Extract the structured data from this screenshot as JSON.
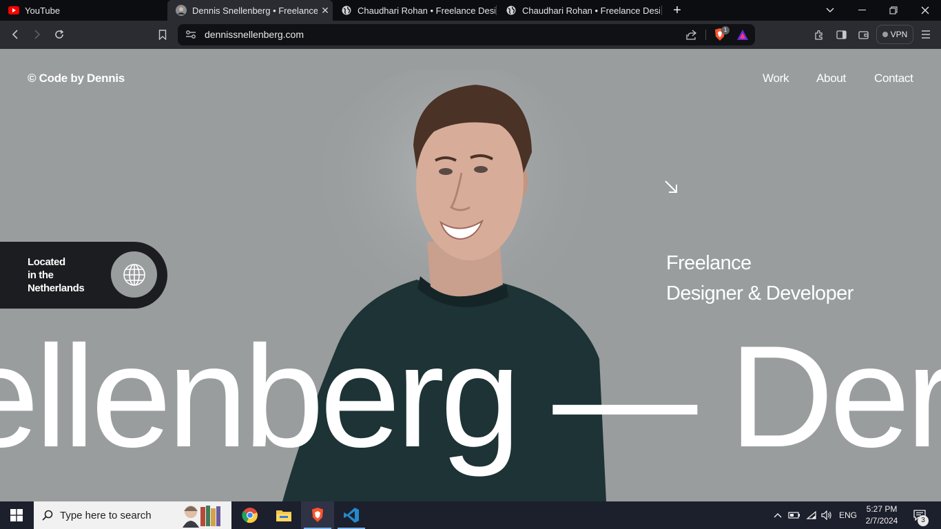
{
  "browser": {
    "tabs": [
      {
        "title": "YouTube",
        "icon": "youtube-icon",
        "active": false
      },
      {
        "title": "Dennis Snellenberg • Freelance Designer & Developer",
        "icon": "avatar-icon",
        "active": true
      },
      {
        "title": "Chaudhari Rohan • Freelance Designer & Developer",
        "icon": "globe-icon",
        "active": false
      },
      {
        "title": "Chaudhari Rohan • Freelance Designer & Developer",
        "icon": "globe-icon",
        "active": false
      }
    ],
    "address": "dennissnellenberg.com",
    "shields_count": "1",
    "vpn_label": "VPN",
    "colors": {
      "brave_orange": "#fb542b",
      "rewards_gradient": "#6a2bd8"
    }
  },
  "page": {
    "brand": "© Code by Dennis",
    "nav": [
      {
        "label": "Work"
      },
      {
        "label": "About"
      },
      {
        "label": "Contact"
      }
    ],
    "location": {
      "line1": "Located",
      "line2": "in the",
      "line3": "Netherlands",
      "icon": "globe-icon"
    },
    "arrow_icon": "arrow-down-right-icon",
    "role_line1": "Freelance",
    "role_line2": "Designer & Developer",
    "marquee": "ellenberg — Der",
    "colors": {
      "background": "#999d9e",
      "pill": "#1c1d20",
      "text": "#ffffff"
    }
  },
  "taskbar": {
    "search_placeholder": "Type here to search",
    "apps": [
      {
        "name": "chrome"
      },
      {
        "name": "file-explorer"
      },
      {
        "name": "brave",
        "active": true
      },
      {
        "name": "vscode"
      }
    ],
    "language": "ENG",
    "time": "5:27 PM",
    "date": "2/7/2024",
    "notifications": "3"
  }
}
